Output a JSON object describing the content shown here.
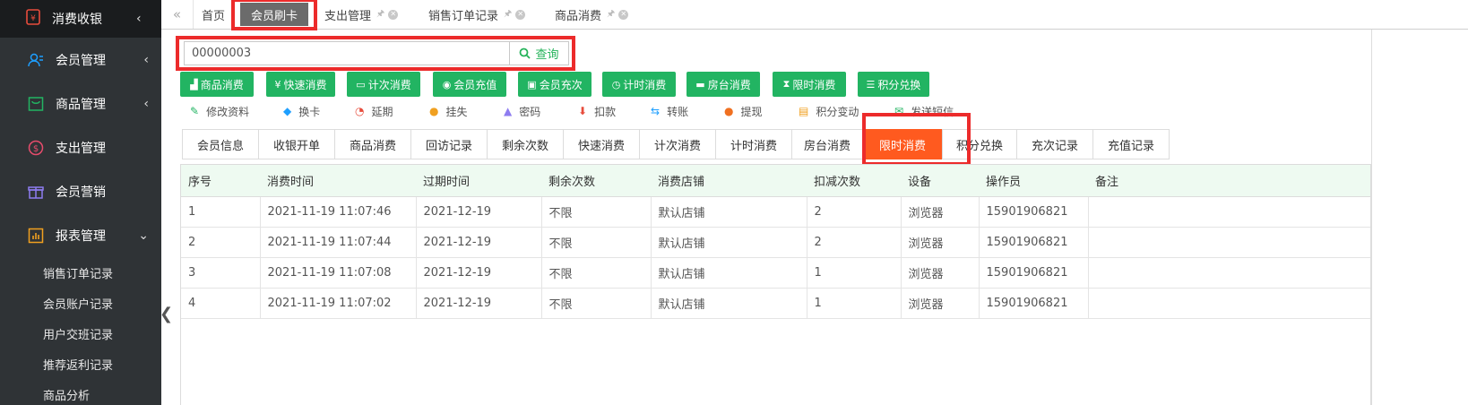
{
  "sidebar": {
    "top": {
      "label": "消费收银",
      "icon": "cashier-icon"
    },
    "items": [
      {
        "label": "会员管理",
        "icon": "member-icon",
        "arrow": "‹",
        "color": "#1e9fff"
      },
      {
        "label": "商品管理",
        "icon": "goods-icon",
        "arrow": "‹",
        "color": "#22b462"
      },
      {
        "label": "支出管理",
        "icon": "expense-icon",
        "arrow": "",
        "color": "#e74c6c"
      },
      {
        "label": "会员营销",
        "icon": "gift-icon",
        "arrow": "",
        "color": "#8e7cf0"
      },
      {
        "label": "报表管理",
        "icon": "report-icon",
        "arrow": "⌄",
        "color": "#f0a020"
      }
    ],
    "subitems": [
      "销售订单记录",
      "会员账户记录",
      "用户交班记录",
      "推荐返利记录",
      "商品分析"
    ]
  },
  "tabs": [
    {
      "label": "首页"
    },
    {
      "label": "会员刷卡"
    },
    {
      "label": "支出管理"
    },
    {
      "label": "销售订单记录"
    },
    {
      "label": "商品消费"
    }
  ],
  "search": {
    "value": "00000003",
    "button": "查询"
  },
  "actions": [
    "商品消费",
    "快速消费",
    "计次消费",
    "会员充值",
    "会员充次",
    "计时消费",
    "房台消费",
    "限时消费",
    "积分兑换"
  ],
  "links": [
    "修改资料",
    "换卡",
    "延期",
    "挂失",
    "密码",
    "扣款",
    "转账",
    "提现",
    "积分变动",
    "发送短信"
  ],
  "subtabs": [
    "会员信息",
    "收银开单",
    "商品消费",
    "回访记录",
    "剩余次数",
    "快速消费",
    "计次消费",
    "计时消费",
    "房台消费",
    "限时消费",
    "积分兑换",
    "充次记录",
    "充值记录"
  ],
  "table": {
    "headers": [
      "序号",
      "消费时间",
      "过期时间",
      "剩余次数",
      "消费店铺",
      "扣减次数",
      "设备",
      "操作员",
      "备注"
    ],
    "rows": [
      [
        "1",
        "2021-11-19 11:07:46",
        "2021-12-19",
        "不限",
        "默认店铺",
        "2",
        "浏览器",
        "15901906821",
        ""
      ],
      [
        "2",
        "2021-11-19 11:07:44",
        "2021-12-19",
        "不限",
        "默认店铺",
        "2",
        "浏览器",
        "15901906821",
        ""
      ],
      [
        "3",
        "2021-11-19 11:07:08",
        "2021-12-19",
        "不限",
        "默认店铺",
        "1",
        "浏览器",
        "15901906821",
        ""
      ],
      [
        "4",
        "2021-11-19 11:07:02",
        "2021-12-19",
        "不限",
        "默认店铺",
        "1",
        "浏览器",
        "15901906821",
        ""
      ]
    ]
  },
  "colors": {
    "accent_green": "#22b462",
    "active_orange": "#ff5a1f",
    "highlight_red": "#ec2b2b",
    "sidebar_bg": "#2f3336"
  }
}
